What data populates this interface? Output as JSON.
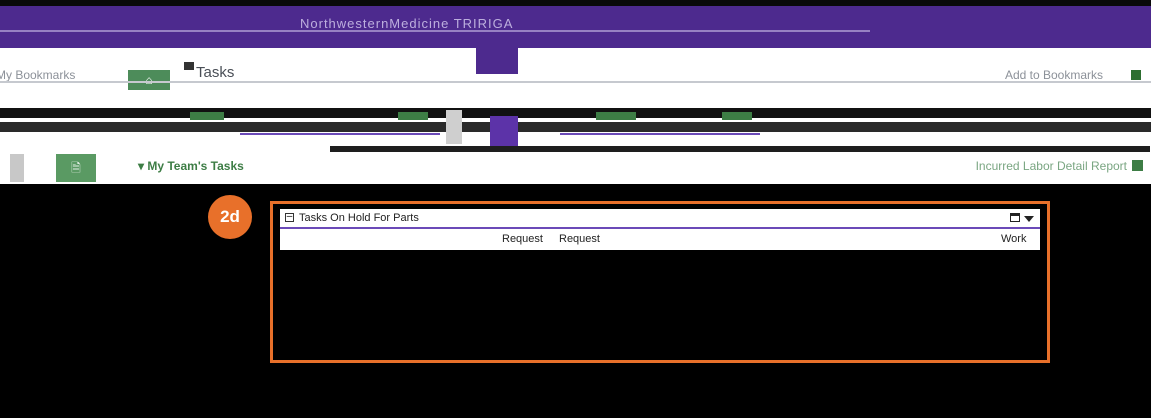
{
  "header": {
    "title": "NorthwesternMedicine TRIRIGA"
  },
  "bookmarks": {
    "my_bookmarks": "My Bookmarks",
    "page_title": "Tasks",
    "add_to_bookmarks": "Add to Bookmarks"
  },
  "section": {
    "my_teams_tasks": "My Team's Tasks",
    "incurred_report": "Incurred Labor Detail Report"
  },
  "callout": {
    "label": "2d"
  },
  "panel": {
    "title": "Tasks On Hold For Parts",
    "columns": [
      "Request",
      "Request",
      "Work"
    ]
  },
  "colors": {
    "brand_purple": "#4d2a8e",
    "accent_green": "#3d7d45",
    "highlight_orange": "#e8702a"
  }
}
